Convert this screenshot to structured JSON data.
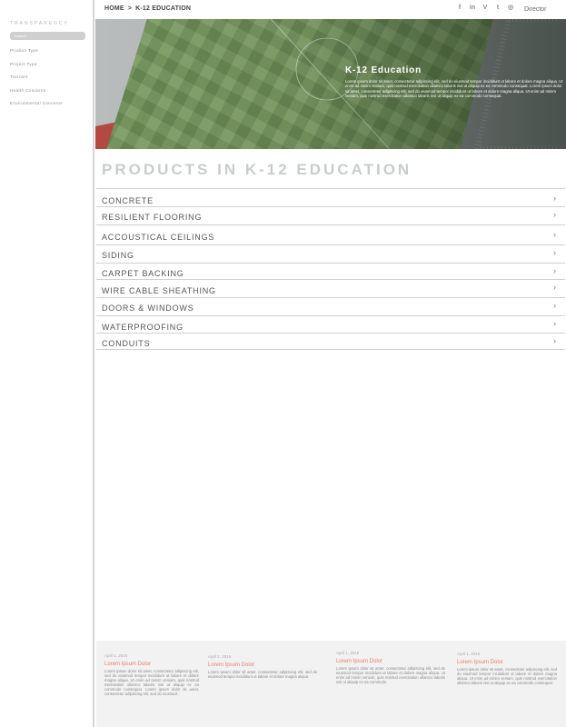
{
  "sidebar": {
    "brand": "TRANSPARENCY",
    "search_placeholder": "Search",
    "items": [
      {
        "label": "Product Type"
      },
      {
        "label": "Project Type"
      },
      {
        "label": "Toxicant"
      },
      {
        "label": "Health Concerns"
      },
      {
        "label": "Environmental Concerns"
      }
    ]
  },
  "topbar": {
    "breadcrumb": {
      "home": "HOME",
      "separator": ">",
      "current": "K-12 EDUCATION"
    },
    "social": [
      {
        "icon": "facebook-icon",
        "glyph": "f"
      },
      {
        "icon": "linkedin-icon",
        "glyph": "in"
      },
      {
        "icon": "vimeo-icon",
        "glyph": "V"
      },
      {
        "icon": "twitter-icon",
        "glyph": "t"
      },
      {
        "icon": "instagram-icon",
        "glyph": "◎"
      }
    ],
    "director_label": "Director"
  },
  "hero": {
    "title": "K-12 Education",
    "text": "Lorem ipsum dolor sit amet, consectetur adipiscing elit, sed do eiusmod tempor incididunt ut labore et dolore magna aliqua. Ut enim ad minim veniam, quis nostrud exercitation ullamco laboris nisi ut aliquip ex ea commodo consequat. Lorem ipsum dolor sit amet, consectetur adipiscing elit, sed do eiusmod tempor incididunt ut labore et dolore magna aliqua. Ut enim ad minim veniam, quis nostrud exercitation ullamco laboris nisi ut aliquip ex ea commodo consequat."
  },
  "products": {
    "heading": "PRODUCTS IN K-12 EDUCATION",
    "chevron": "›",
    "items": [
      {
        "label": "CONCRETE"
      },
      {
        "label": "RESILIENT FLOORING"
      },
      {
        "label": "ACCOUSTICAL CEILINGS"
      },
      {
        "label": "SIDING"
      },
      {
        "label": "CARPET BACKING"
      },
      {
        "label": "WIRE CABLE SHEATHING"
      },
      {
        "label": "DOORS & WINDOWS"
      },
      {
        "label": "WATERPROOFING"
      },
      {
        "label": "CONDUITS"
      }
    ]
  },
  "footer": {
    "posts": [
      {
        "date": "April 1, 2016",
        "title": "Lorem Ipsum Dolor",
        "body": "Lorem ipsum dolor sit amet, consectetur adipiscing elit, sed do eiusmod tempor incididunt ut labore et dolore magna aliqua. Ut enim ad minim veniam, quis nostrud exercitation ullamco laboris nisi ut aliquip ex ea commodo consequat. Lorem ipsum dolor sit amet, consectetur adipiscing elit, sed do eiusmod."
      },
      {
        "date": "April 1, 2016",
        "title": "Lorem Ipsum Dolor",
        "body": "Lorem ipsum dolor sit amet, consectetur adipiscing elit, sed do eiusmod tempor incididunt ut labore et dolore magna aliqua."
      },
      {
        "date": "April 1, 2016",
        "title": "Lorem Ipsum Dolor",
        "body": "Lorem ipsum dolor sit amet, consectetur adipiscing elit, sed do eiusmod tempor incididunt ut labore et dolore magna aliqua. Ut enim ad minim veniam, quis nostrud exercitation ullamco laboris nisi ut aliquip ex ea commodo."
      },
      {
        "date": "April 1, 2016",
        "title": "Lorem Ipsum Dolor",
        "body": "Lorem ipsum dolor sit amet, consectetur adipiscing elit, sed do eiusmod tempor incididunt ut labore et dolore magna aliqua. Ut enim ad minim veniam, quis nostrud exercitation ullamco laboris nisi ut aliquip ex ea commodo consequat."
      }
    ]
  },
  "colors": {
    "accent": "#e8806c",
    "heading_gray": "#c9cccc",
    "field_light": "#7fa067",
    "field_dark": "#3f5d37"
  }
}
